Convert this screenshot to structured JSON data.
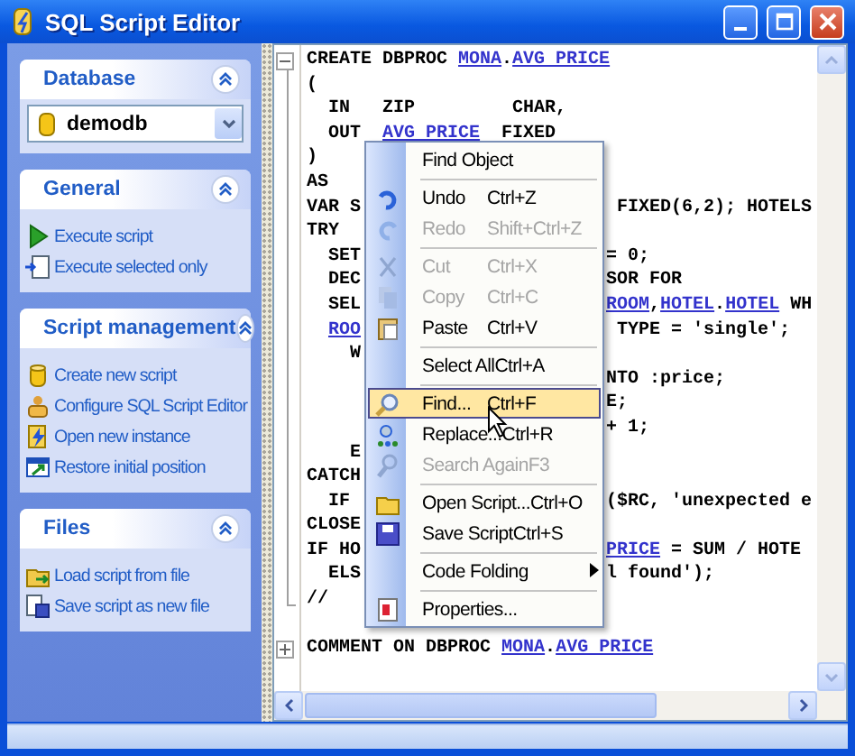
{
  "window": {
    "title": "SQL Script Editor"
  },
  "sidebar": {
    "panels": [
      {
        "title": "Database",
        "expanded": true,
        "kind": "combo",
        "value": "demodb"
      },
      {
        "title": "General",
        "expanded": true,
        "kind": "links",
        "items": [
          "Execute script",
          "Execute selected only"
        ]
      },
      {
        "title": "Script management",
        "expanded": true,
        "kind": "links",
        "items": [
          "Create new script",
          "Configure SQL Script Editor",
          "Open new instance",
          "Restore initial position"
        ]
      },
      {
        "title": "Files",
        "expanded": true,
        "kind": "links",
        "items": [
          "Load script from file",
          "Save script as new file"
        ]
      }
    ]
  },
  "editor": {
    "lines": [
      {
        "kind": "full",
        "folded": false,
        "segments": [
          {
            "kind": "plain",
            "text": "CREATE DBPROC "
          },
          {
            "kind": "link",
            "text": "MONA"
          },
          {
            "kind": "plain",
            "text": "."
          },
          {
            "kind": "link",
            "text": "AVG PRICE"
          }
        ]
      },
      {
        "kind": "full",
        "segments": [
          {
            "kind": "plain",
            "text": "("
          }
        ]
      },
      {
        "kind": "full",
        "segments": [
          {
            "kind": "plain",
            "text": "  IN   ZIP         CHAR,"
          }
        ]
      },
      {
        "kind": "full",
        "segments": [
          {
            "kind": "plain",
            "text": "  OUT  "
          },
          {
            "kind": "link",
            "text": "AVG PRICE"
          },
          {
            "kind": "plain",
            "text": "  FIXED"
          }
        ]
      },
      {
        "kind": "full",
        "segments": [
          {
            "kind": "plain",
            "text": ")"
          }
        ]
      },
      {
        "kind": "full",
        "segments": [
          {
            "kind": "plain",
            "text": "AS"
          }
        ]
      },
      {
        "kind": "split",
        "before": [
          {
            "kind": "plain",
            "text": "VAR S"
          }
        ],
        "after": [
          {
            "kind": "plain",
            "text": " FIXED(6,2); HOTELS"
          }
        ]
      },
      {
        "kind": "split",
        "before": [
          {
            "kind": "plain",
            "text": "TRY"
          }
        ]
      },
      {
        "kind": "split",
        "before": [
          {
            "kind": "plain",
            "text": "  SET"
          }
        ],
        "after": [
          {
            "kind": "plain",
            "text": "= 0;"
          }
        ]
      },
      {
        "kind": "split",
        "before": [
          {
            "kind": "plain",
            "text": "  DEC"
          }
        ],
        "after": [
          {
            "kind": "plain",
            "text": "SOR FOR"
          }
        ]
      },
      {
        "kind": "split",
        "before": [
          {
            "kind": "plain",
            "text": "  SEL"
          }
        ],
        "after": [
          {
            "kind": "link",
            "text": "ROOM"
          },
          {
            "kind": "plain",
            "text": ","
          },
          {
            "kind": "link",
            "text": "HOTEL"
          },
          {
            "kind": "plain",
            "text": "."
          },
          {
            "kind": "link",
            "text": "HOTEL"
          },
          {
            "kind": "plain",
            "text": " WH"
          }
        ]
      },
      {
        "kind": "split",
        "before": [
          {
            "kind": "link",
            "text": "ROO"
          }
        ],
        "after": [
          {
            "kind": "plain",
            "text": " TYPE = 'single';"
          }
        ]
      },
      {
        "kind": "split",
        "before": [
          {
            "kind": "plain",
            "text": "    W"
          }
        ]
      },
      {
        "kind": "split",
        "after": [
          {
            "kind": "plain",
            "text": "NTO :price;"
          }
        ]
      },
      {
        "kind": "split",
        "after": [
          {
            "kind": "plain",
            "text": "E;"
          }
        ]
      },
      {
        "kind": "split",
        "after": [
          {
            "kind": "plain",
            "text": "+ 1;"
          }
        ]
      },
      {
        "kind": "split",
        "before": [
          {
            "kind": "plain",
            "text": "    E"
          }
        ]
      },
      {
        "kind": "split",
        "before": [
          {
            "kind": "plain",
            "text": "CATCH"
          }
        ]
      },
      {
        "kind": "split",
        "before": [
          {
            "kind": "plain",
            "text": "  IF"
          }
        ],
        "after": [
          {
            "kind": "plain",
            "text": "($RC, 'unexpected e"
          }
        ]
      },
      {
        "kind": "split",
        "before": [
          {
            "kind": "plain",
            "text": "CLOSE"
          }
        ]
      },
      {
        "kind": "split",
        "before": [
          {
            "kind": "plain",
            "text": "IF HO"
          }
        ],
        "after": [
          {
            "kind": "link",
            "text": "PRICE"
          },
          {
            "kind": "plain",
            "text": " = SUM / HOTE"
          }
        ]
      },
      {
        "kind": "split",
        "before": [
          {
            "kind": "plain",
            "text": "  ELS"
          }
        ],
        "after": [
          {
            "kind": "plain",
            "text": "l found');"
          }
        ]
      },
      {
        "kind": "split",
        "before": [
          {
            "kind": "plain",
            "text": "//"
          }
        ]
      },
      {
        "kind": "blank"
      },
      {
        "kind": "full",
        "folded": true,
        "segments": [
          {
            "kind": "plain",
            "text": "COMMENT ON DBPROC "
          },
          {
            "kind": "link",
            "text": "MONA"
          },
          {
            "kind": "plain",
            "text": "."
          },
          {
            "kind": "link",
            "text": "AVG PRICE"
          }
        ]
      }
    ]
  },
  "context_menu": {
    "items": [
      {
        "kind": "item",
        "label": "Find Object",
        "disabled": false,
        "selected": false
      },
      {
        "kind": "separator"
      },
      {
        "kind": "item",
        "label": "Undo",
        "shortcut": "Ctrl+Z",
        "disabled": false,
        "selected": false
      },
      {
        "kind": "item",
        "label": "Redo",
        "shortcut": "Shift+Ctrl+Z",
        "disabled": true,
        "selected": false
      },
      {
        "kind": "separator"
      },
      {
        "kind": "item",
        "label": "Cut",
        "shortcut": "Ctrl+X",
        "disabled": true,
        "selected": false
      },
      {
        "kind": "item",
        "label": "Copy",
        "shortcut": "Ctrl+C",
        "disabled": true,
        "selected": false
      },
      {
        "kind": "item",
        "label": "Paste",
        "shortcut": "Ctrl+V",
        "disabled": false,
        "selected": false
      },
      {
        "kind": "separator"
      },
      {
        "kind": "item",
        "label": "Select All",
        "shortcut": "Ctrl+A",
        "disabled": false,
        "selected": false
      },
      {
        "kind": "separator"
      },
      {
        "kind": "item",
        "label": "Find...",
        "shortcut": "Ctrl+F",
        "disabled": false,
        "selected": true
      },
      {
        "kind": "item",
        "label": "Replace...",
        "shortcut": "Ctrl+R",
        "disabled": false,
        "selected": false
      },
      {
        "kind": "item",
        "label": "Search Again",
        "shortcut": "F3",
        "disabled": true,
        "selected": false
      },
      {
        "kind": "separator"
      },
      {
        "kind": "item",
        "label": "Open Script...",
        "shortcut": "Ctrl+O",
        "disabled": false,
        "selected": false
      },
      {
        "kind": "item",
        "label": "Save Script",
        "shortcut": "Ctrl+S",
        "disabled": false,
        "selected": false
      },
      {
        "kind": "separator"
      },
      {
        "kind": "submenu",
        "label": "Code Folding",
        "disabled": false,
        "selected": false
      },
      {
        "kind": "separator"
      },
      {
        "kind": "item",
        "label": "Properties...",
        "disabled": false,
        "selected": false
      }
    ]
  }
}
